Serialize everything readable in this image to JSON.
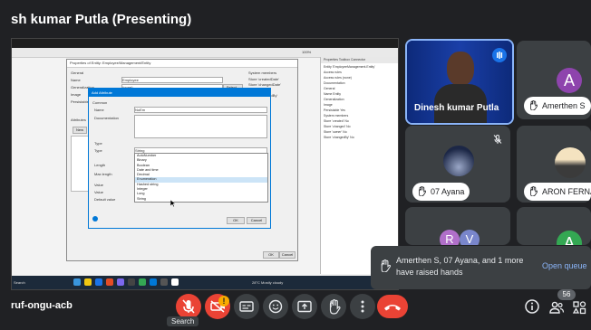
{
  "header": {
    "presenter_title": "sh kumar Putla (Presenting)"
  },
  "shared_screen": {
    "window_title": "Vacation Tracking (Main-Vaci - 8.12.4",
    "menu": [
      "App",
      "Run",
      "Version Control",
      "Language",
      "Help"
    ],
    "dialog_outer": {
      "title": "Properties of Entity: Employee/Management/Entity",
      "general_label": "General",
      "rows": [
        {
          "label": "Name",
          "value": "Employee"
        },
        {
          "label": "Generalization",
          "value": "(none)"
        },
        {
          "label": "Image",
          "value": ""
        },
        {
          "label": "Persistable",
          "value": ""
        }
      ],
      "system_members_label": "System members",
      "system_members": [
        "Store 'createdDate'",
        "Store 'changedDate'",
        "Store 'owner'",
        "Store 'changedBy'"
      ],
      "attributes_label": "Attributes",
      "new_btn": "New",
      "select_btn": "Select...",
      "ok": "OK",
      "cancel": "Cancel"
    },
    "dialog_inner": {
      "title": "Add Attribute",
      "common_label": "Common",
      "name_label": "Name",
      "name_value": "NoEm",
      "doc_label": "Documentation",
      "type_section_label": "Type",
      "type_label": "Type",
      "type_value": "String",
      "length_label": "Length",
      "maxlength_label": "Max length",
      "value_section": "Value",
      "value_label": "Value",
      "default_label": "Default value",
      "options": [
        "AutoNumber",
        "Binary",
        "Boolean",
        "Date and time",
        "Decimal",
        "Enumeration",
        "Hashed string",
        "Integer",
        "Long",
        "String"
      ],
      "selected_option": "Enumeration",
      "ok": "OK",
      "cancel": "Cancel"
    },
    "side_panel": {
      "tabs": [
        "Properties",
        "Toolbox",
        "Connector"
      ],
      "title": "Entity 'EmployeeManagement.Entity'",
      "rows": [
        "Access rules",
        "Access rules (none)",
        "Documentation",
        "General",
        "Name Entity",
        "Generalization",
        "Image",
        "Persistable Yes",
        "System members",
        "Store 'created' No",
        "Store 'changed' No",
        "Store 'owner' No",
        "Store 'changedBy' No"
      ]
    },
    "taskbar": {
      "search": "Search",
      "weather": "28°C Mostly cloudy",
      "clock": "10:34"
    },
    "zoom": "100%"
  },
  "participants": [
    {
      "name": "Dinesh kumar Putla",
      "type": "video",
      "hand": false
    },
    {
      "name": "Amerthen S",
      "initial": "A",
      "color": "#8e44ad",
      "hand": true
    },
    {
      "name": "07 Ayana",
      "hand": true,
      "muted": true
    },
    {
      "name": "ARON FERNA",
      "hand": true
    },
    {
      "name": "",
      "initials": [
        "R",
        "V"
      ],
      "hand": false
    },
    {
      "name": "",
      "initial": "A",
      "color": "#34a853",
      "hand": false
    }
  ],
  "toast": {
    "text": "Amerthen S, 07 Ayana, and 1 more have raised hands",
    "link": "Open queue"
  },
  "bottom": {
    "meeting_code": "ruf-ongu-acb",
    "badge": "!",
    "tooltip": "Search",
    "people_count": "56"
  },
  "colors": {
    "accent_blue": "#8ab4f8",
    "danger": "#ea4335",
    "tile": "#3c4043"
  }
}
